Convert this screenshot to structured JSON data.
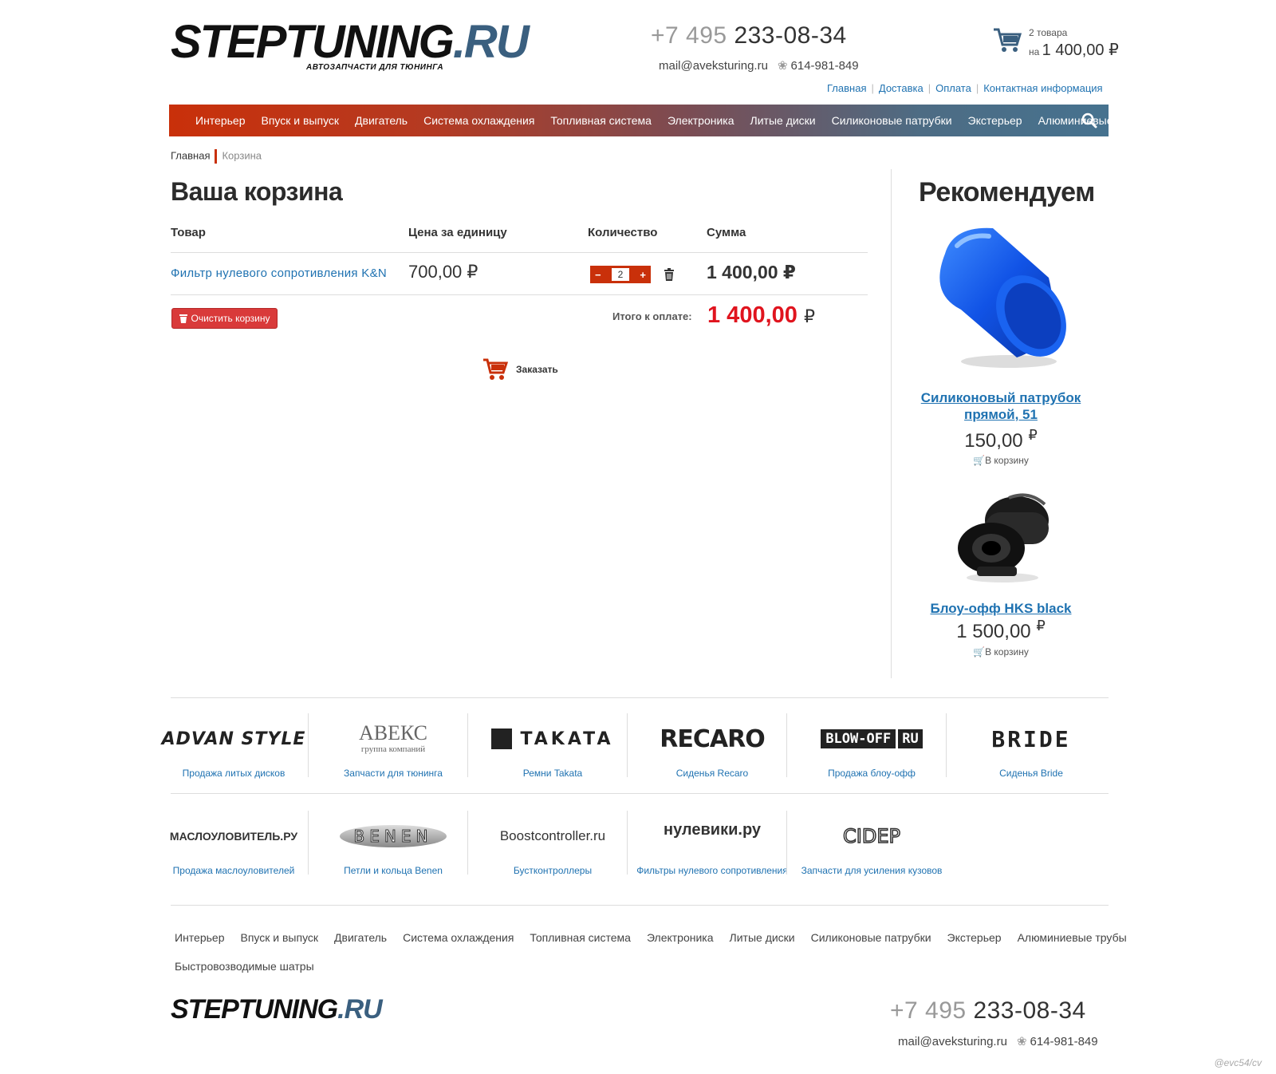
{
  "header": {
    "logo_main": "STEPTUNING",
    "logo_ru": ".RU",
    "logo_sub": "АВТОЗАПЧАСТИ ДЛЯ ТЮНИНГА",
    "phone_prefix": "+7 495",
    "phone_number": "233-08-34",
    "email": "mail@aveksturing.ru",
    "icq": "614-981-849",
    "cart_count": "2 товара",
    "cart_on": "на",
    "cart_total": "1 400,00 ₽",
    "links": [
      "Главная",
      "Доставка",
      "Оплата",
      "Контактная информация"
    ]
  },
  "nav": {
    "items": [
      "Интерьер",
      "Впуск и выпуск",
      "Двигатель",
      "Система охлаждения",
      "Топливная система",
      "Электроника",
      "Литые диски",
      "Силиконовые патрубки",
      "Экстерьер",
      "Алюминиевые трубы"
    ]
  },
  "breadcrumb": {
    "home": "Главная",
    "current": "Корзина"
  },
  "cart": {
    "title": "Ваша корзина",
    "col_product": "Товар",
    "col_price": "Цена за единицу",
    "col_qty": "Количество",
    "col_sum": "Сумма",
    "item_name": "Фильтр нулевого сопротивления K&N",
    "item_price": "700,00 ₽",
    "item_qty": "2",
    "minus": "−",
    "plus": "+",
    "item_sum": "1 400,00 ₽",
    "clear_label": "Очистить корзину",
    "total_label": "Итого к оплате:",
    "total_value": "1 400,00",
    "total_currency": "₽",
    "order_label": "Заказать"
  },
  "recommend": {
    "title": "Рекомендуем",
    "items": [
      {
        "name": "Силиконовый патрубок прямой, 51",
        "price": "150,00",
        "currency": "₽",
        "cart": "В корзину"
      },
      {
        "name": "Блоу-офф HKS black",
        "price": "1 500,00",
        "currency": "₽",
        "cart": "В корзину"
      }
    ]
  },
  "brands": {
    "row1": [
      {
        "logo": "ADVAN STYLE",
        "caption": "Продажа литых дисков"
      },
      {
        "logo": "АВЕКС",
        "logo_sub": "группа компаний",
        "caption": "Запчасти для тюнинга"
      },
      {
        "logo": "TAKATA",
        "caption": "Ремни Takata"
      },
      {
        "logo": "RECARO",
        "caption": "Сиденья Recaro"
      },
      {
        "logo": "BLOW-OFF",
        "logo_ru": "RU",
        "caption": "Продажа блоу-офф"
      },
      {
        "logo": "BRIDE",
        "caption": "Сиденья Bride"
      }
    ],
    "row2": [
      {
        "logo": "МАСЛОУЛОВИТЕЛЬ.РУ",
        "caption": "Продажа маслоуловителей"
      },
      {
        "logo": "BENEN",
        "caption": "Петли и кольца Benen"
      },
      {
        "logo": "Boostcontroller.ru",
        "caption": "Бустконтроллеры"
      },
      {
        "logo": "нулевики.ру",
        "caption": "Фильтры нулевого сопротивления"
      },
      {
        "logo": "CIDEP",
        "caption": "Запчасти для усиления кузовов"
      }
    ]
  },
  "footer": {
    "nav": [
      "Интерьер",
      "Впуск и выпуск",
      "Двигатель",
      "Система охлаждения",
      "Топливная система",
      "Электроника",
      "Литые диски",
      "Силиконовые патрубки",
      "Экстерьер",
      "Алюминиевые трубы"
    ],
    "nav2": "Быстровозводимые шатры",
    "logo_main": "STEPTUNING",
    "logo_ru": ".RU",
    "phone_prefix": "+7 495",
    "phone_number": "233-08-34",
    "email": "mail@aveksturing.ru",
    "icq": "614-981-849"
  },
  "watermark": "@evc54/cv",
  "colors": {
    "accent": "#c9300a",
    "link": "#1f72b1",
    "total": "#e0141e",
    "nav_end": "#46728f"
  }
}
